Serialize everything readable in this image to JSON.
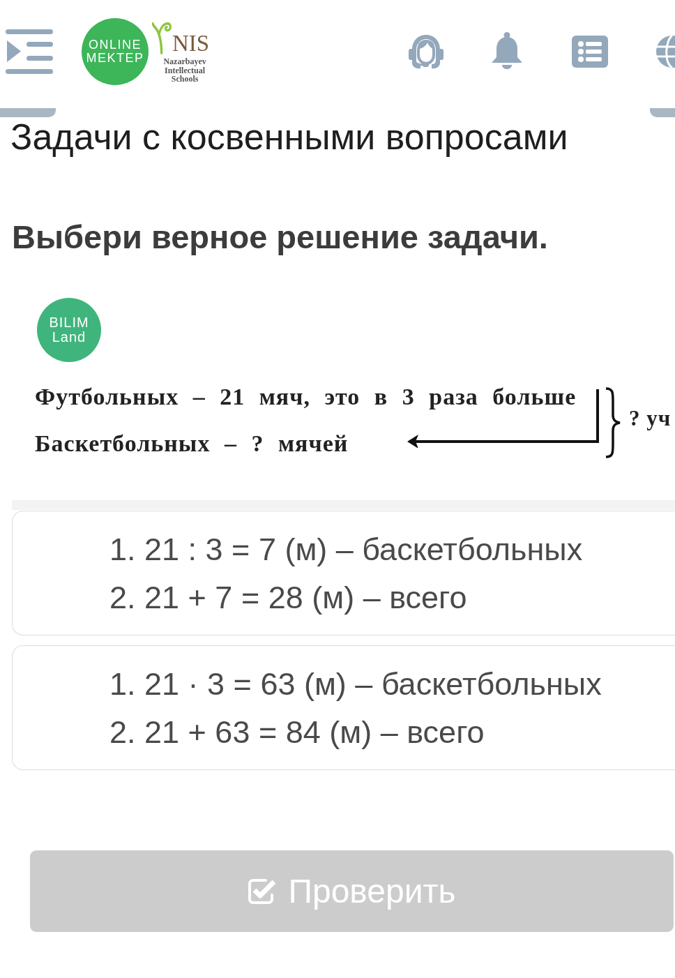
{
  "header": {
    "brand_logo": [
      "ONLINE",
      "MEKTEP"
    ],
    "partner_logo": {
      "mark": "NIS",
      "caption": [
        "Nazarbayev",
        "Intellectual",
        "Schools"
      ]
    }
  },
  "page_title": "Задачи с косвенными вопросами",
  "task": {
    "prompt": "Выбери верное решение задачи.",
    "source_logo": [
      "BILIM",
      "Land"
    ],
    "problem": {
      "lines": [
        "Футбольных – 21 мяч, это в 3 раза больше",
        "Баскетбольных – ? мячей"
      ],
      "brace_label": "? уч"
    }
  },
  "options": [
    {
      "lines": [
        "1. 21 : 3 = 7 (м) – баскетбольных",
        "2. 21 + 7 = 28 (м) – всего"
      ],
      "selected": false
    },
    {
      "lines": [
        "1. 21 · 3 = 63 (м) – баскетбольных",
        "2. 21 + 63 = 84 (м) – всего"
      ],
      "selected": false
    }
  ],
  "submit": {
    "label": "Проверить",
    "disabled": true
  }
}
